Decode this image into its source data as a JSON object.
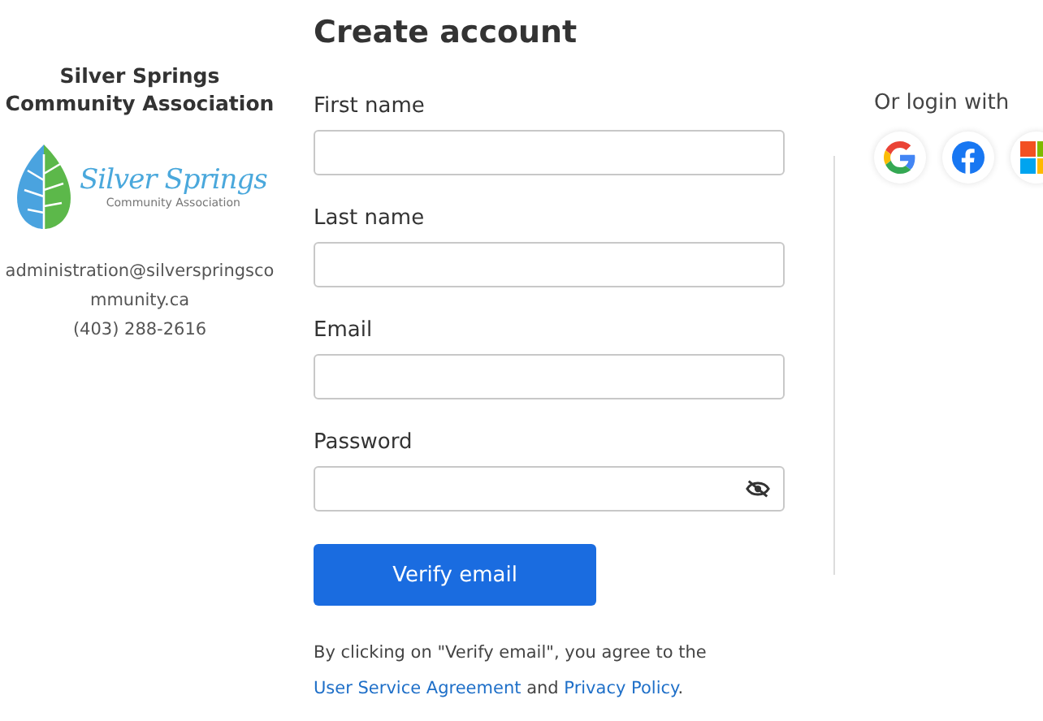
{
  "organization": {
    "name": "Silver Springs Community Association",
    "logo": {
      "wordmark": "Silver Springs",
      "tagline": "Community Association"
    },
    "email": "administration@silverspringscommunity.ca",
    "phone": "(403) 288-2616"
  },
  "form": {
    "title": "Create account",
    "fields": [
      {
        "label": "First name",
        "kind": "text"
      },
      {
        "label": "Last name",
        "kind": "text"
      },
      {
        "label": "Email",
        "kind": "text"
      },
      {
        "label": "Password",
        "kind": "password"
      }
    ],
    "submit": "Verify email",
    "agreement": {
      "before": "By clicking on \"Verify email\", you agree to the ",
      "link1": "User Service Agreement",
      "middle": " and ",
      "link2": "Privacy Policy",
      "after": "."
    }
  },
  "social": {
    "title": "Or login with",
    "providers": [
      {
        "kind": "google"
      },
      {
        "kind": "facebook"
      },
      {
        "kind": "microsoft"
      }
    ]
  }
}
